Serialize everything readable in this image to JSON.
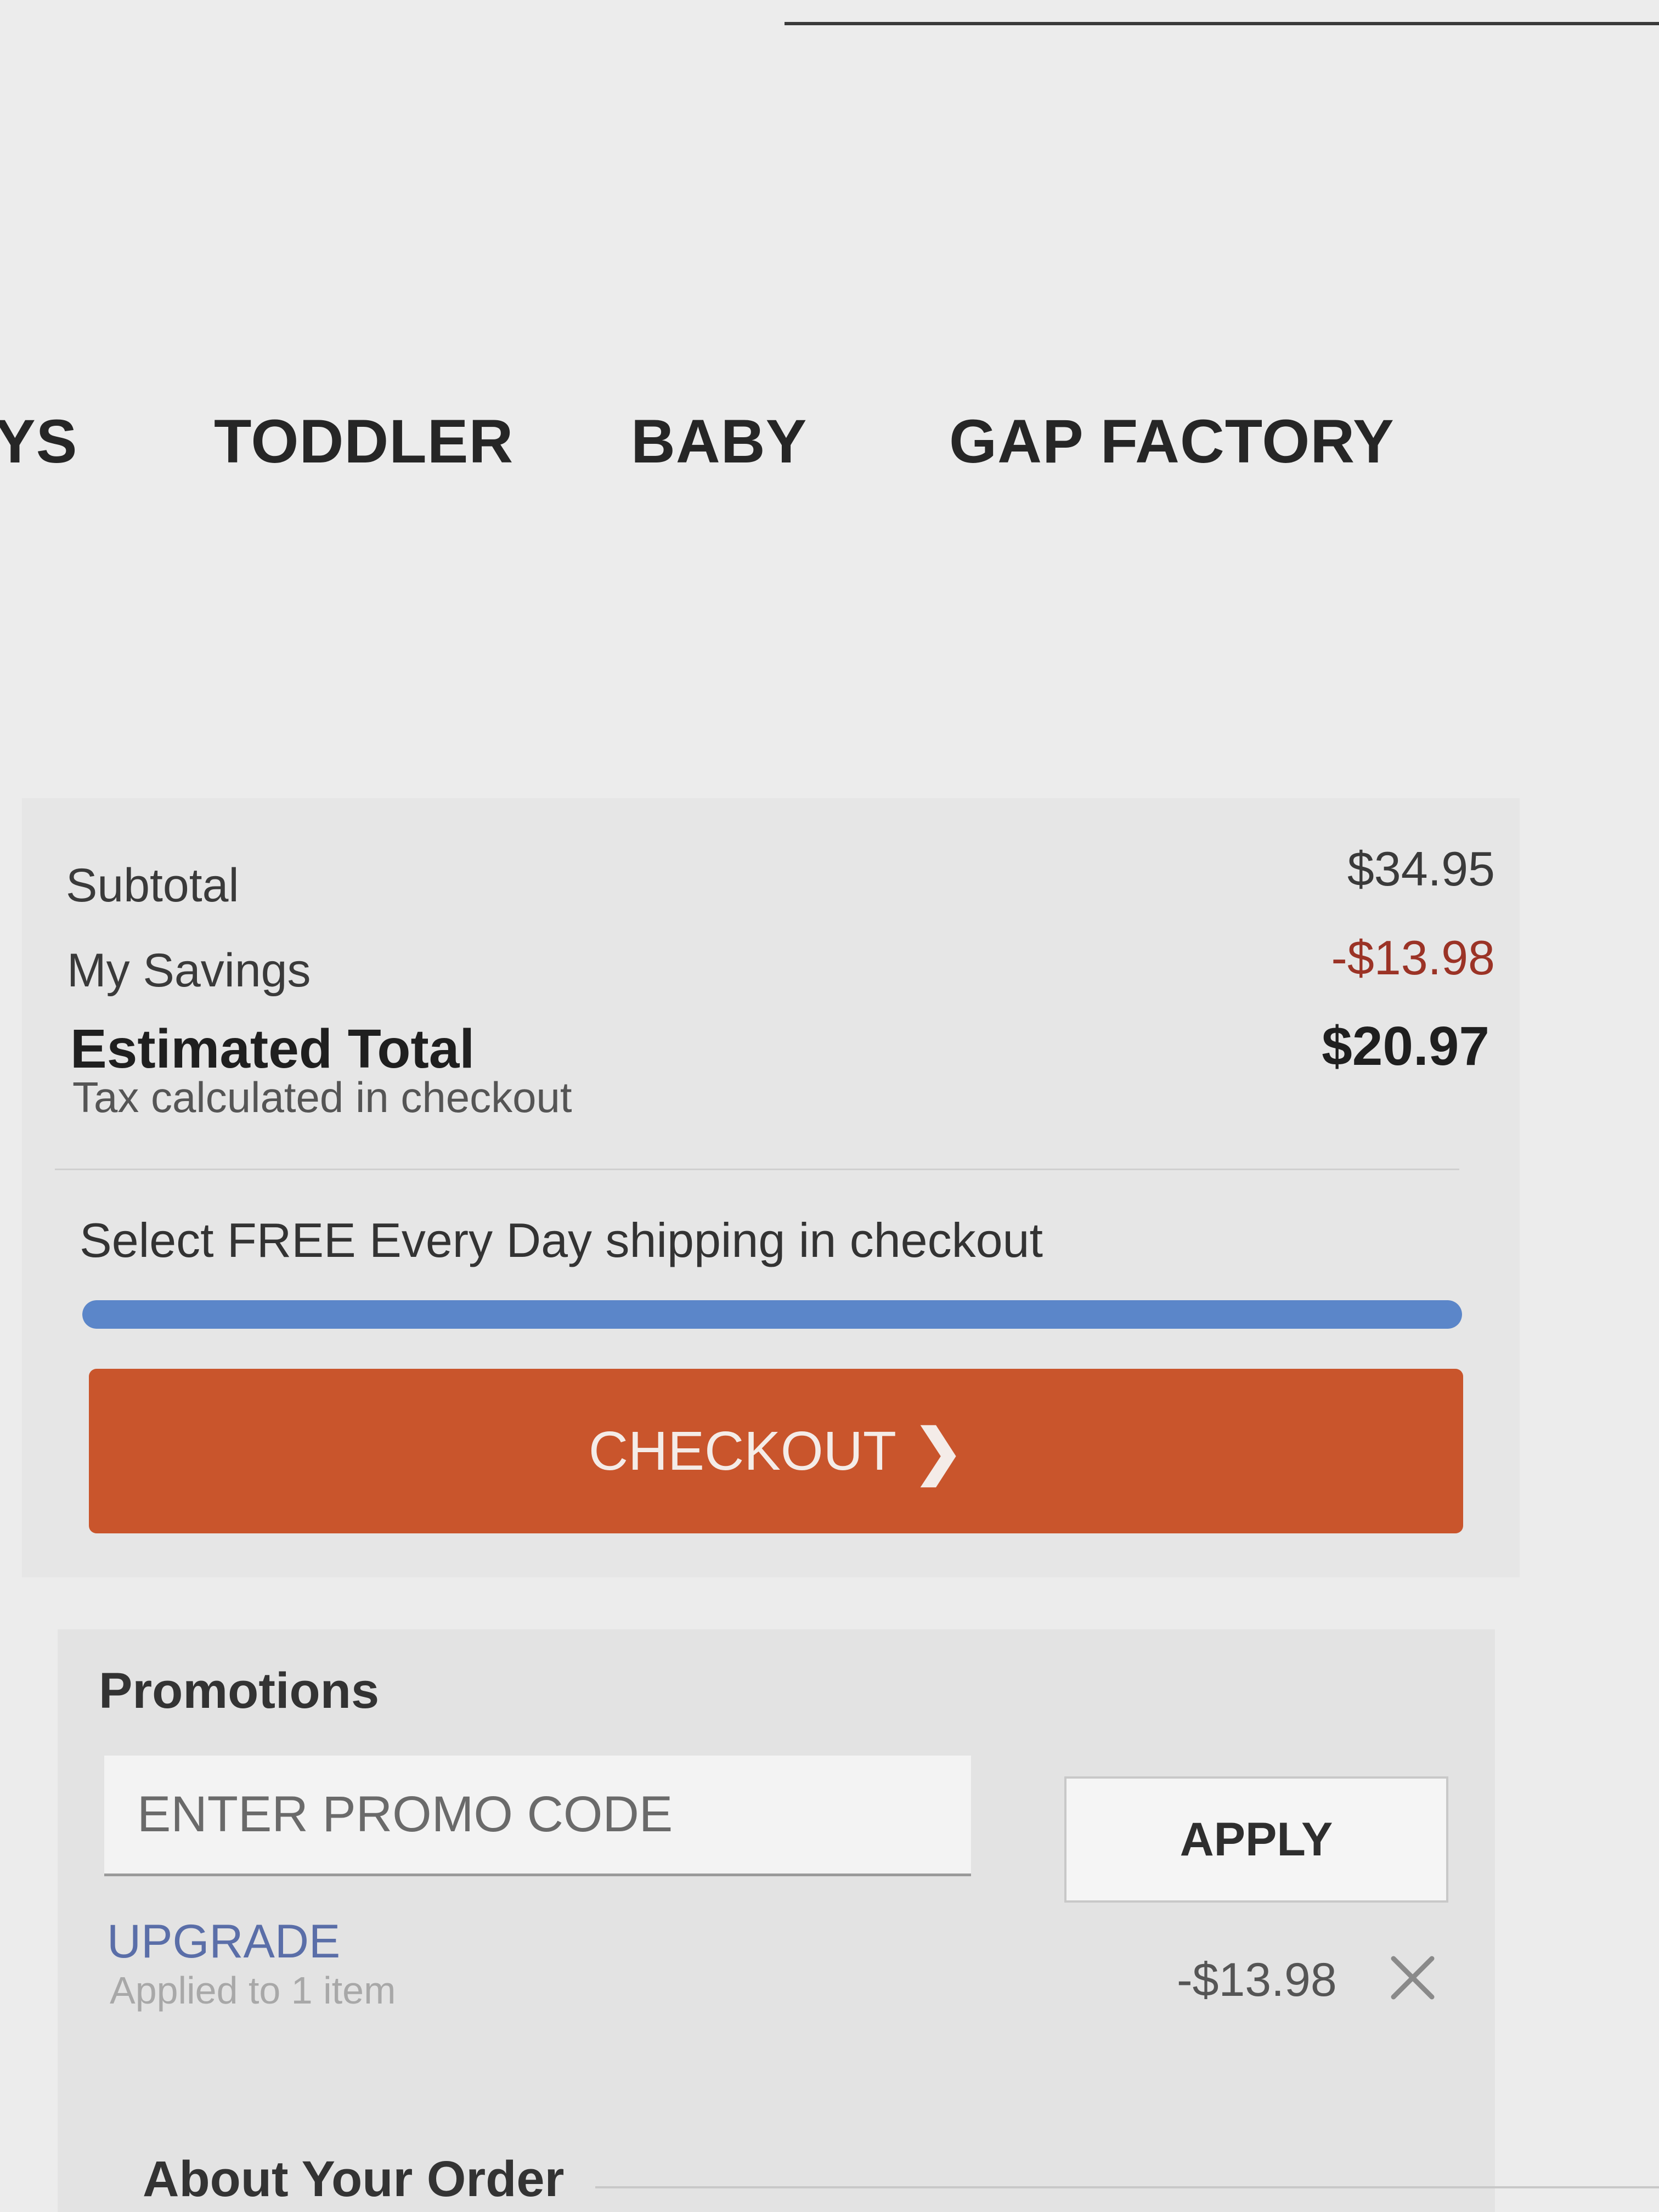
{
  "nav": {
    "items": [
      {
        "label": "YS"
      },
      {
        "label": "TODDLER"
      },
      {
        "label": "BABY"
      },
      {
        "label": "GAP FACTORY"
      }
    ]
  },
  "summary": {
    "subtotal_label": "Subtotal",
    "subtotal_value": "$34.95",
    "savings_label": "My Savings",
    "savings_value": "-$13.98",
    "total_label": "Estimated Total",
    "total_value": "$20.97",
    "tax_note": "Tax calculated in checkout",
    "shipping_message": "Select FREE Every Day shipping in checkout",
    "shipping_progress": 1.0,
    "checkout_label": "CHECKOUT",
    "checkout_icon": "chevron-right-icon",
    "colors": {
      "checkout_button": "#c9552c",
      "progress_fill": "#5b86c9",
      "savings_text": "#9b3326"
    }
  },
  "promotions": {
    "title": "Promotions",
    "input_placeholder": "ENTER PROMO CODE",
    "apply_label": "APPLY",
    "applied": {
      "code": "UPGRADE",
      "note": "Applied to 1 item",
      "amount": "-$13.98",
      "remove_icon": "close-icon"
    }
  },
  "about": {
    "title": "About Your Order"
  }
}
